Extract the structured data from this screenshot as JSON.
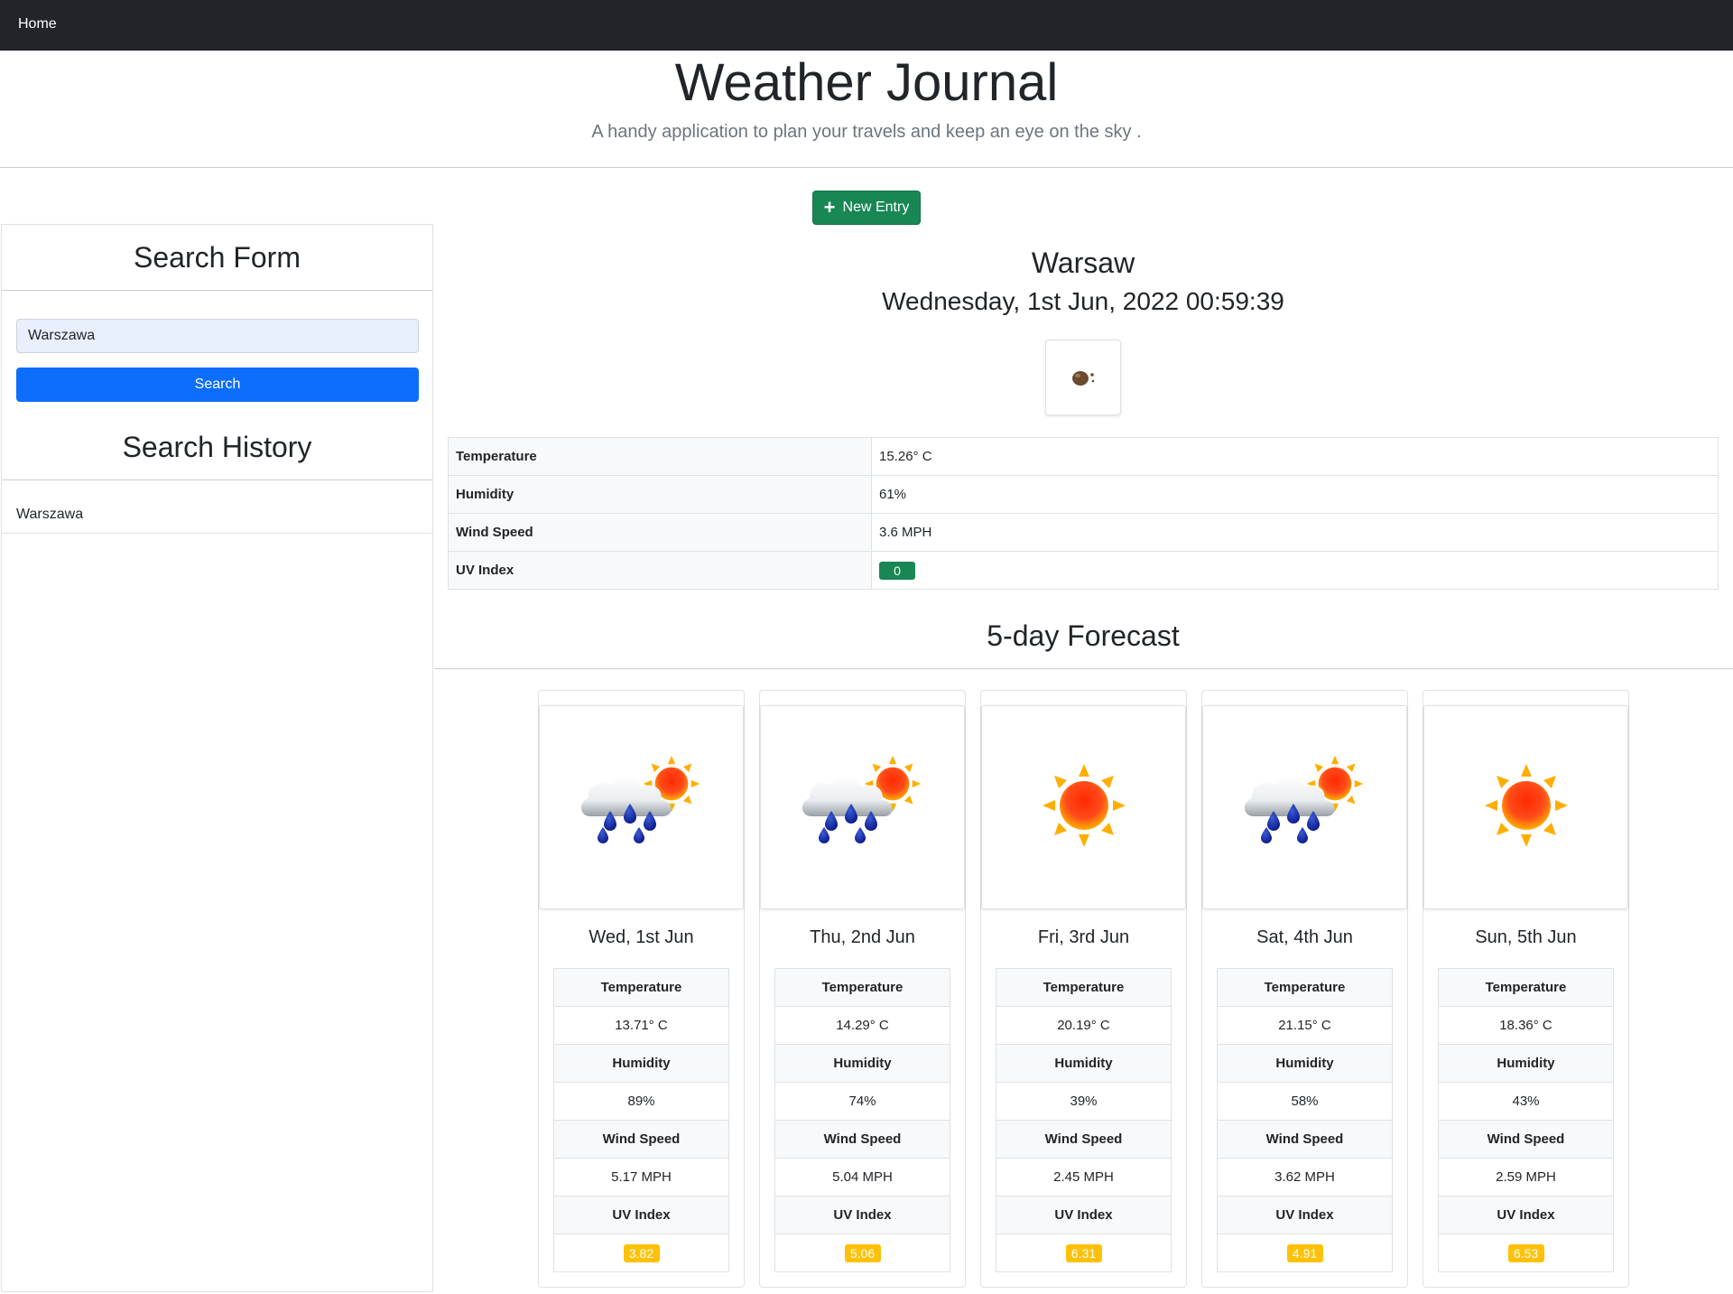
{
  "nav": {
    "home_label": "Home"
  },
  "header": {
    "title": "Weather Journal",
    "subtitle": "A handy application to plan your travels and keep an eye on the sky ."
  },
  "new_entry": {
    "label": "New Entry",
    "icon": "plus-icon"
  },
  "sidebar": {
    "search_form_title": "Search Form",
    "search_input_value": "Warszawa",
    "search_button_label": "Search",
    "search_history_title": "Search History",
    "history": [
      "Warszawa"
    ]
  },
  "current": {
    "city": "Warsaw",
    "datetime": "Wednesday, 1st Jun, 2022 00:59:39",
    "icon": "weather-icon",
    "rows": [
      {
        "label": "Temperature",
        "value": "15.26° C"
      },
      {
        "label": "Humidity",
        "value": "61%"
      },
      {
        "label": "Wind Speed",
        "value": "3.6 MPH"
      },
      {
        "label": "UV Index",
        "value": "0"
      }
    ],
    "uv_color": "#198754"
  },
  "forecast": {
    "title": "5-day Forecast",
    "labels": {
      "temperature": "Temperature",
      "humidity": "Humidity",
      "wind": "Wind Speed",
      "uv": "UV Index"
    },
    "days": [
      {
        "date": "Wed, 1st Jun",
        "icon": "rain-sun-icon",
        "temperature": "13.71° C",
        "humidity": "89%",
        "wind": "5.17 MPH",
        "uv": "3.82"
      },
      {
        "date": "Thu, 2nd Jun",
        "icon": "rain-sun-icon",
        "temperature": "14.29° C",
        "humidity": "74%",
        "wind": "5.04 MPH",
        "uv": "5.06"
      },
      {
        "date": "Fri, 3rd Jun",
        "icon": "sun-icon",
        "temperature": "20.19° C",
        "humidity": "39%",
        "wind": "2.45 MPH",
        "uv": "6.31"
      },
      {
        "date": "Sat, 4th Jun",
        "icon": "rain-sun-icon",
        "temperature": "21.15° C",
        "humidity": "58%",
        "wind": "3.62 MPH",
        "uv": "4.91"
      },
      {
        "date": "Sun, 5th Jun",
        "icon": "sun-icon",
        "temperature": "18.36° C",
        "humidity": "43%",
        "wind": "2.59 MPH",
        "uv": "6.53"
      }
    ],
    "uv_color": "#ffc107"
  }
}
